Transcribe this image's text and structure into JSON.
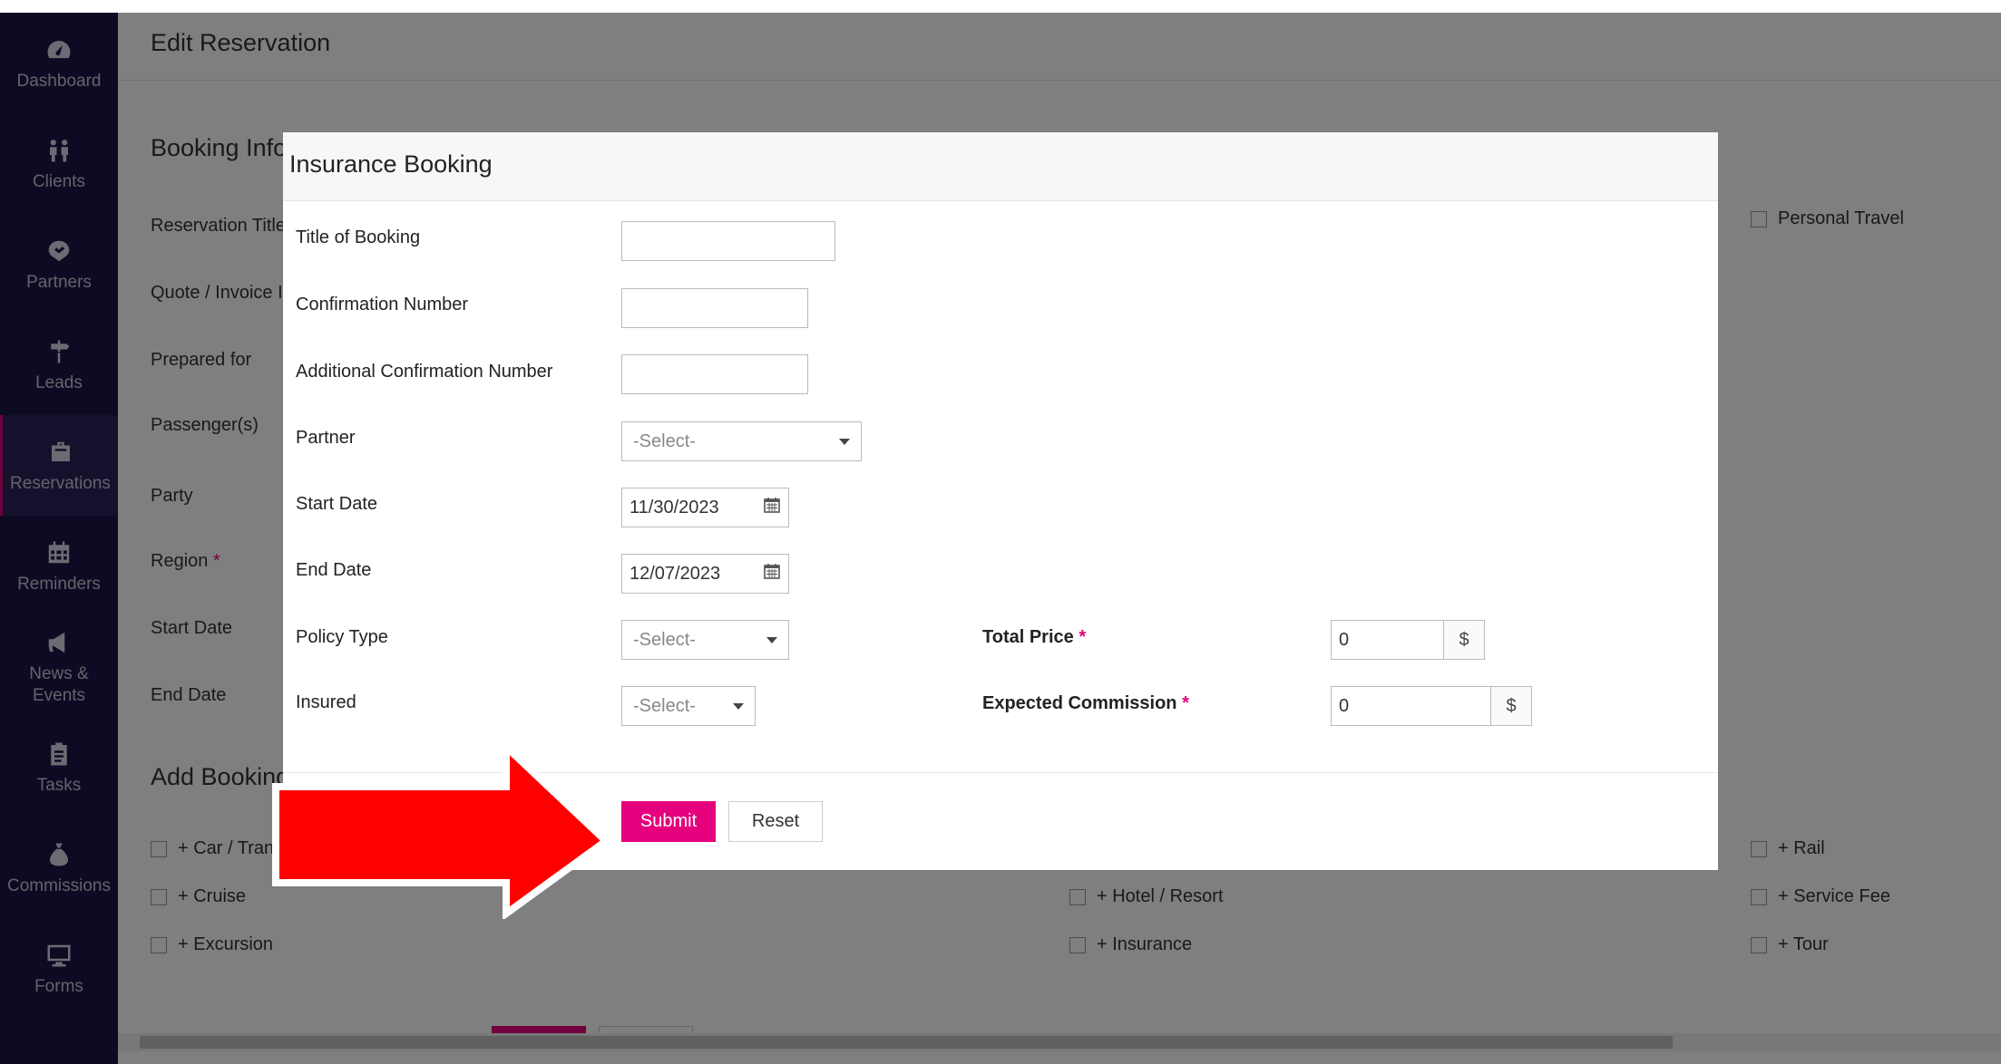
{
  "colors": {
    "accent": "#e5007d",
    "sidebar": "#1a1547",
    "arrow": "#ff0000"
  },
  "sidebar": {
    "items": [
      {
        "label": "Dashboard",
        "icon": "dashboard-icon"
      },
      {
        "label": "Clients",
        "icon": "people-icon"
      },
      {
        "label": "Partners",
        "icon": "handshake-icon"
      },
      {
        "label": "Leads",
        "icon": "signpost-icon"
      },
      {
        "label": "Reservations",
        "icon": "suitcase-icon",
        "active": true
      },
      {
        "label": "Reminders",
        "icon": "calendar-icon"
      },
      {
        "label": "News &",
        "label2": "Events",
        "icon": "megaphone-icon"
      },
      {
        "label": "Tasks",
        "icon": "clipboard-icon"
      },
      {
        "label": "Commissions",
        "icon": "money-bag-icon"
      },
      {
        "label": "Forms",
        "icon": "monitor-icon"
      }
    ]
  },
  "page": {
    "title": "Edit Reservation",
    "booking_info_title": "Booking Info",
    "labels": {
      "reservation_title": "Reservation Title",
      "quote_invoice": "Quote / Invoice I",
      "prepared_for": "Prepared for",
      "passengers": "Passenger(s)",
      "party": "Party",
      "region": "Region",
      "region_req": "*",
      "start_date": "Start Date",
      "end_date": "End Date"
    },
    "personal_travel": "Personal Travel",
    "add_booking_title": "Add Booking",
    "add_booking_items": {
      "car": "+ Car / Trans",
      "cruise": "+ Cruise",
      "excursion": "+ Excursion",
      "hotel": "+ Hotel / Resort",
      "insurance": "+ Insurance",
      "rail": "+ Rail",
      "service_fee": "+ Service Fee",
      "tour": "+ Tour"
    }
  },
  "modal": {
    "title": "Insurance Booking",
    "fields": {
      "title_of_booking": {
        "label": "Title of Booking",
        "value": ""
      },
      "confirmation_number": {
        "label": "Confirmation Number",
        "value": ""
      },
      "additional_confirmation_number": {
        "label": "Additional Confirmation Number",
        "value": ""
      },
      "partner": {
        "label": "Partner",
        "value": "-Select-"
      },
      "start_date": {
        "label": "Start Date",
        "value": "11/30/2023"
      },
      "end_date": {
        "label": "End Date",
        "value": "12/07/2023"
      },
      "policy_type": {
        "label": "Policy Type",
        "value": "-Select-"
      },
      "insured": {
        "label": "Insured",
        "value": "-Select-"
      },
      "total_price": {
        "label": "Total Price",
        "req": "*",
        "value": "0",
        "unit": "$"
      },
      "expected_commission": {
        "label": "Expected Commission",
        "req": "*",
        "value": "0",
        "unit": "$"
      }
    },
    "submit_label": "Submit",
    "reset_label": "Reset"
  }
}
